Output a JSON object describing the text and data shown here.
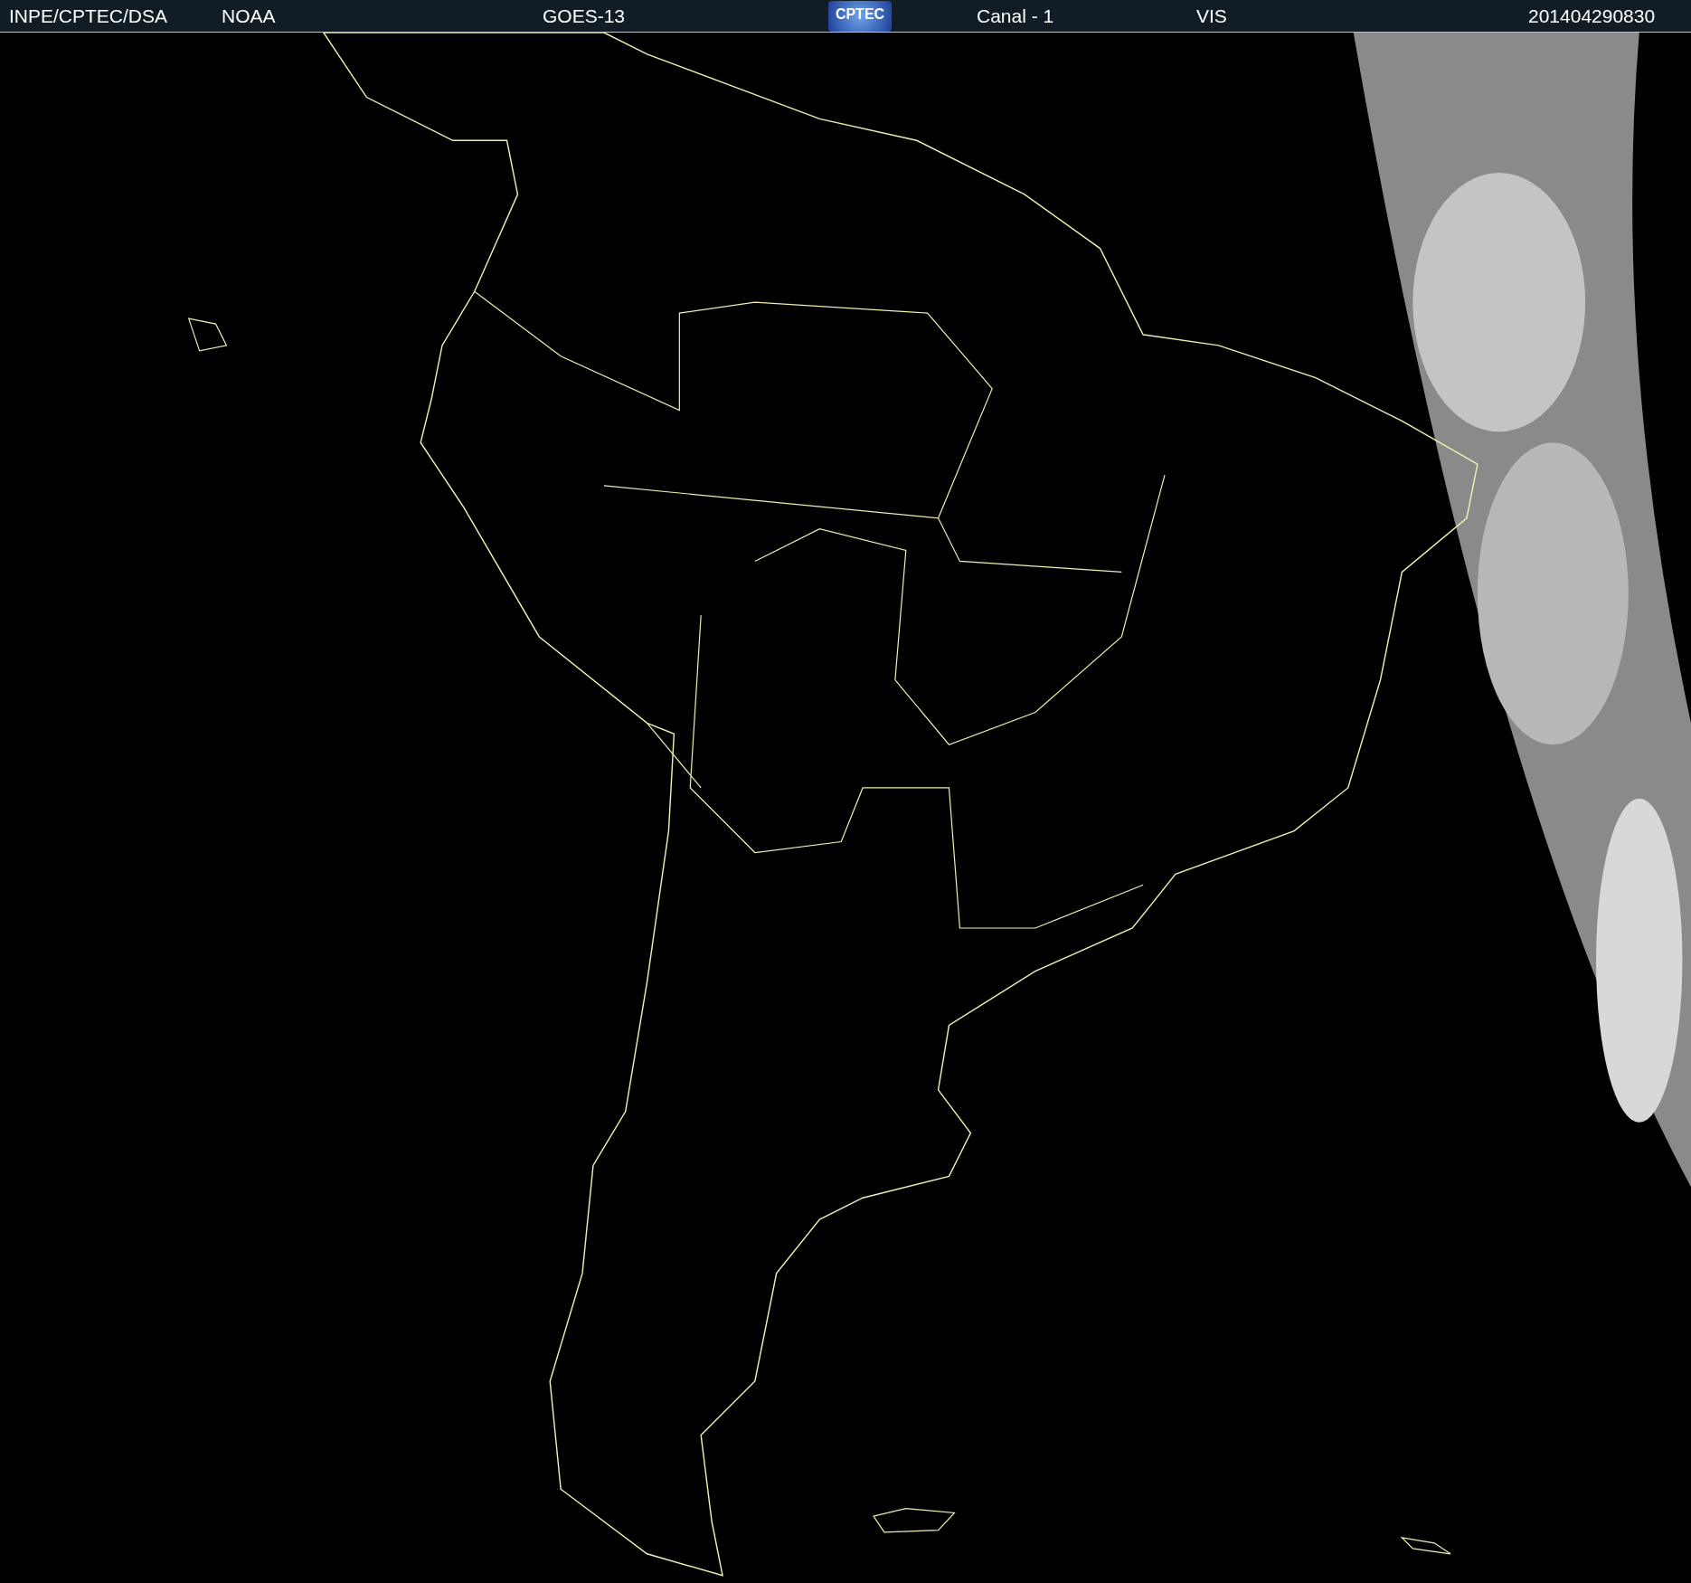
{
  "header": {
    "items": [
      {
        "kind": "text",
        "text": "INPE/CPTEC/DSA"
      },
      {
        "kind": "text",
        "text": "NOAA"
      },
      {
        "kind": "text",
        "text": "GOES-13"
      },
      {
        "kind": "logo",
        "text": "CPTEC"
      },
      {
        "kind": "text",
        "text": "Canal - 1"
      },
      {
        "kind": "text",
        "text": "VIS"
      },
      {
        "kind": "text",
        "text": "201404290830"
      }
    ]
  }
}
